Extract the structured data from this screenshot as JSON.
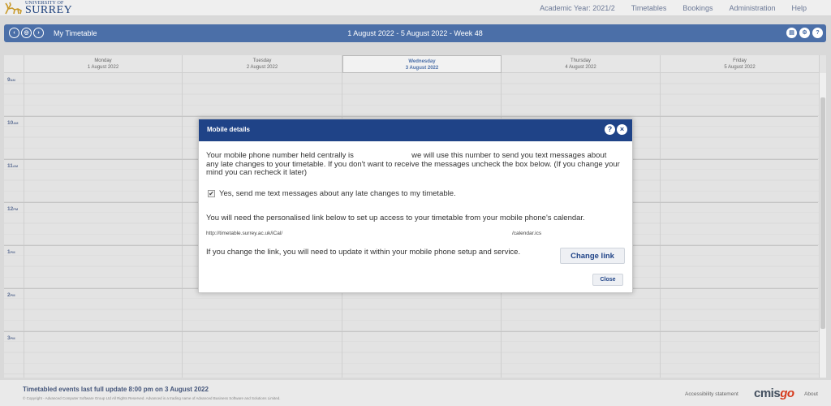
{
  "header": {
    "logo_small": "UNIVERSITY OF",
    "logo_big": "SURREY",
    "nav": [
      "Academic Year: 2021/2",
      "Timetables",
      "Bookings",
      "Administration",
      "Help"
    ]
  },
  "toolbar": {
    "title": "My Timetable",
    "date_range": "1 August 2022 - 5 August 2022 - Week 48",
    "prev_icon": "‹",
    "today_icon": "◎",
    "next_icon": "›",
    "print_icon": "▤",
    "settings_icon": "⚙",
    "help_icon": "?"
  },
  "days": [
    {
      "name": "Monday",
      "date": "1 August 2022"
    },
    {
      "name": "Tuesday",
      "date": "2 August 2022"
    },
    {
      "name": "Wednesday",
      "date": "3 August 2022"
    },
    {
      "name": "Thursday",
      "date": "4 August 2022"
    },
    {
      "name": "Friday",
      "date": "5 August 2022"
    }
  ],
  "today_index": 2,
  "times": [
    {
      "hour": "9",
      "ampm": "AM"
    },
    {
      "hour": "10",
      "ampm": "AM"
    },
    {
      "hour": "11",
      "ampm": "AM"
    },
    {
      "hour": "12",
      "ampm": "PM"
    },
    {
      "hour": "1",
      "ampm": "PM"
    },
    {
      "hour": "2",
      "ampm": "PM"
    },
    {
      "hour": "3",
      "ampm": "PM"
    }
  ],
  "modal": {
    "title": "Mobile details",
    "p1_a": "Your mobile phone number held centrally is",
    "p1_b": "we will use this number to send you text messages about any late changes to your timetable. If you don't want to receive the messages uncheck the box below. (If you change your mind you can recheck it later)",
    "checkbox_label": "Yes, send me text messages about any late changes to my timetable.",
    "checkbox_checked": "✔",
    "p2": "You will need the personalised link below to set up access to your timetable from your mobile phone's calendar.",
    "link_prefix": "http://timetable.surrey.ac.uk/iCal/",
    "link_suffix": "/calendar.ics",
    "p3": "If you change the link, you will need to update it within your mobile phone setup and service.",
    "change_link": "Change link",
    "close": "Close"
  },
  "footer": {
    "update": "Timetabled events last full update 8:00 pm on 3 August 2022",
    "copyright": "© Copyright - Advanced Computer Software Group Ltd All Rights Reserved. Advanced is a trading name of Advanced Business Software and Solutions Limited.",
    "accessibility": "Accessibility statement",
    "brand_a": "cmis",
    "brand_b": "go",
    "about": "About"
  }
}
